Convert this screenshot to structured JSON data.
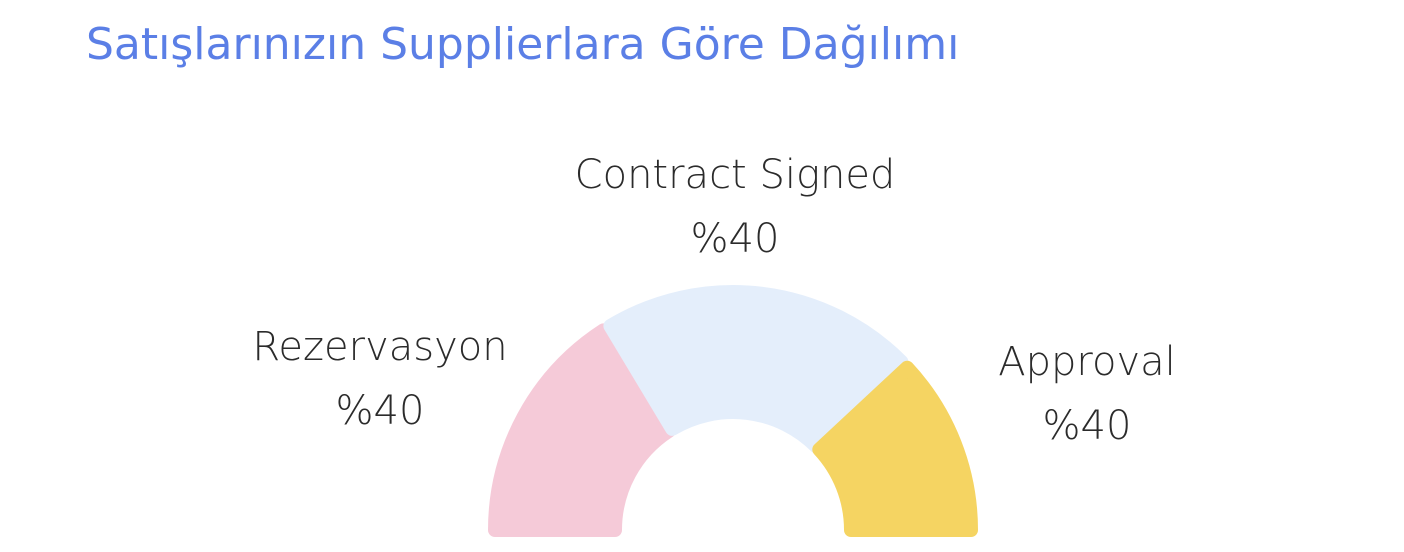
{
  "title": "Satışlarınızın Supplierlara Göre Dağılımı",
  "colors": {
    "title": "#5b7fe6"
  },
  "chart_data": {
    "type": "pie",
    "variant": "half-donut",
    "title": "Satışlarınızın Supplierlara Göre Dağılımı",
    "slices": [
      {
        "name": "Rezervasyon",
        "label": "%40",
        "color": "#f5cad8"
      },
      {
        "name": "Contract Signed",
        "label": "%40",
        "color": "#e4eefb"
      },
      {
        "name": "Approval",
        "label": "%40",
        "color": "#f5d462"
      }
    ]
  }
}
